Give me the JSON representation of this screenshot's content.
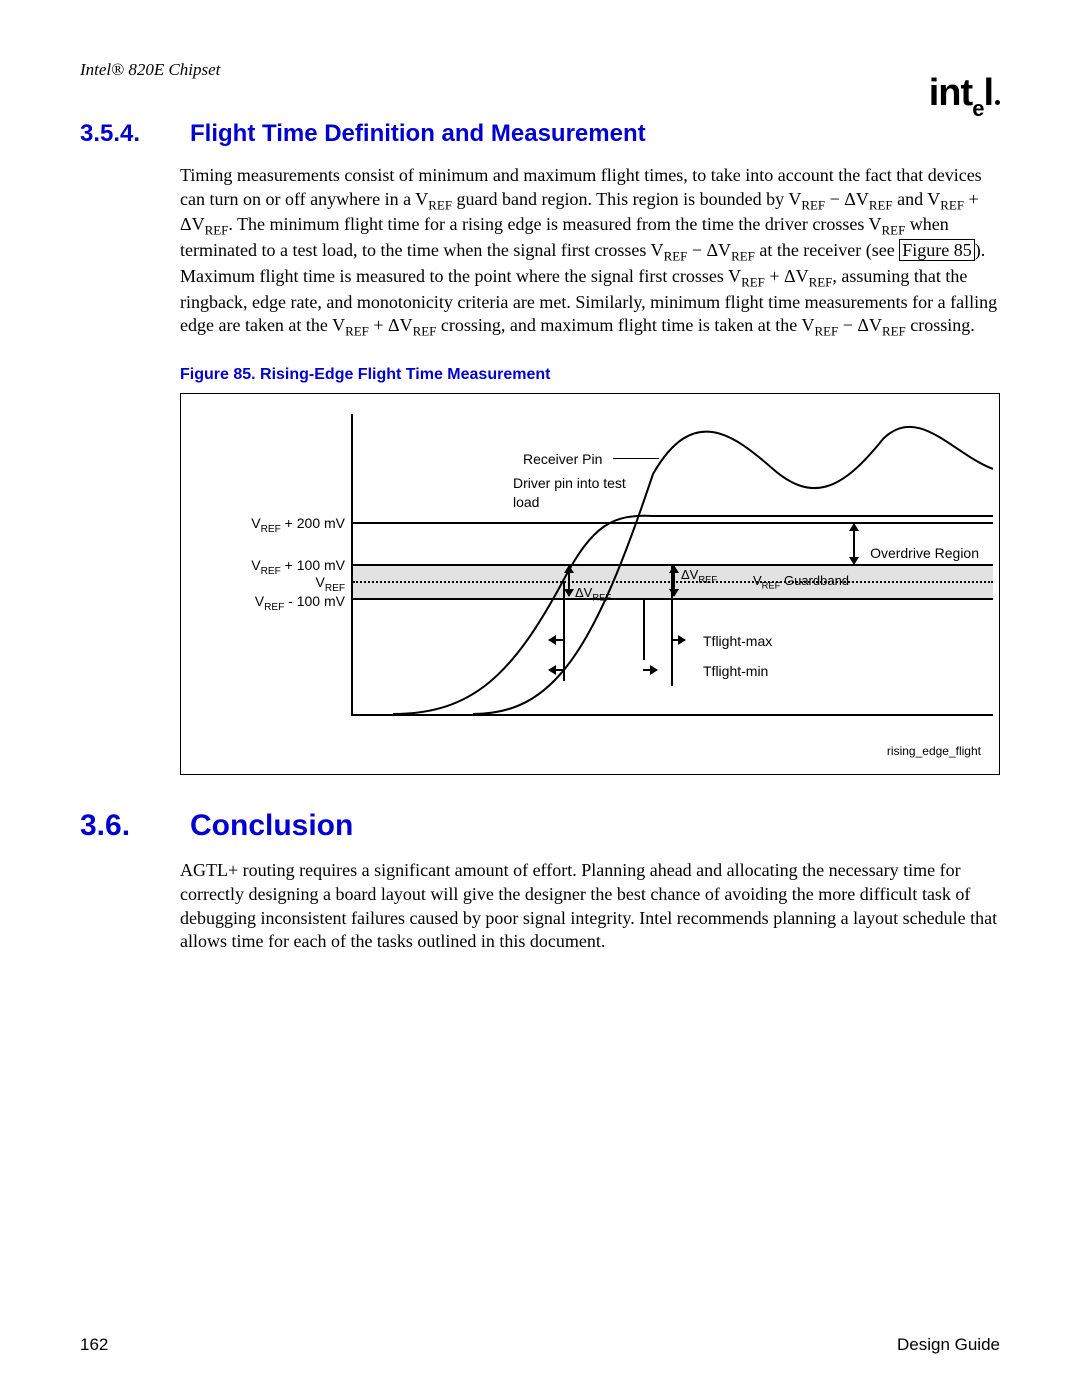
{
  "header": {
    "running": "Intel® 820E Chipset",
    "logo_text": "intel"
  },
  "section354": {
    "num": "3.5.4.",
    "title": "Flight Time Definition and Measurement",
    "para_a": "Timing measurements consist of minimum and maximum flight times, to take into account the fact that devices can turn on or off anywhere in a V",
    "para_b": " guard band region. This region is bounded by V",
    "para_c": " − ΔV",
    "para_d": " and V",
    "para_e": " + ΔV",
    "para_f": ". The minimum flight time for a rising edge is measured from the time the driver crosses V",
    "para_g": " when terminated to a test load, to the time when the signal first crosses V",
    "para_h": " − ΔV",
    "para_i": " at the receiver (see ",
    "fig_ref": "Figure 85",
    "para_j": "). Maximum flight time is measured to the point where the signal first crosses V",
    "para_k": " + ΔV",
    "para_l": ", assuming that the ringback, edge rate, and monotonicity criteria are met. Similarly, minimum flight time measurements for a falling edge are taken at the V",
    "para_m": " + ΔV",
    "para_n": " crossing, and maximum flight time is taken at the V",
    "para_o": " − ΔV",
    "para_p": " crossing.",
    "ref_sub": "REF"
  },
  "figure85": {
    "caption": "Figure 85. Rising-Edge Flight Time Measurement",
    "ylabels": {
      "vref_p200": "Vᴿᴱᴿ + 200 mV",
      "vref_p100": "Vᴿᴱᴿ + 100 mV",
      "vref": "Vᴿᴱᴿ",
      "vref_m100": "Vᴿᴱᴿ - 100 mV"
    },
    "labels": {
      "receiver": "Receiver Pin",
      "driver": "Driver pin into test load",
      "overdrive": "Overdrive Region",
      "guardband": "Guardband",
      "dvref": "ΔV",
      "ref_sub": "REF",
      "vref_plain": "V",
      "tflight_max": "Tflight-max",
      "tflight_min": "Tflight-min",
      "corner": "rising_edge_flight"
    }
  },
  "section36": {
    "num": "3.6.",
    "title": "Conclusion",
    "para": "AGTL+ routing requires a significant amount of effort. Planning ahead and allocating the necessary time for correctly designing a board layout will give the designer the best chance of avoiding the more difficult task of debugging inconsistent failures caused by poor signal integrity. Intel recommends planning a layout schedule that allows time for each of the tasks outlined in this document."
  },
  "footer": {
    "page": "162",
    "doc": "Design Guide"
  }
}
